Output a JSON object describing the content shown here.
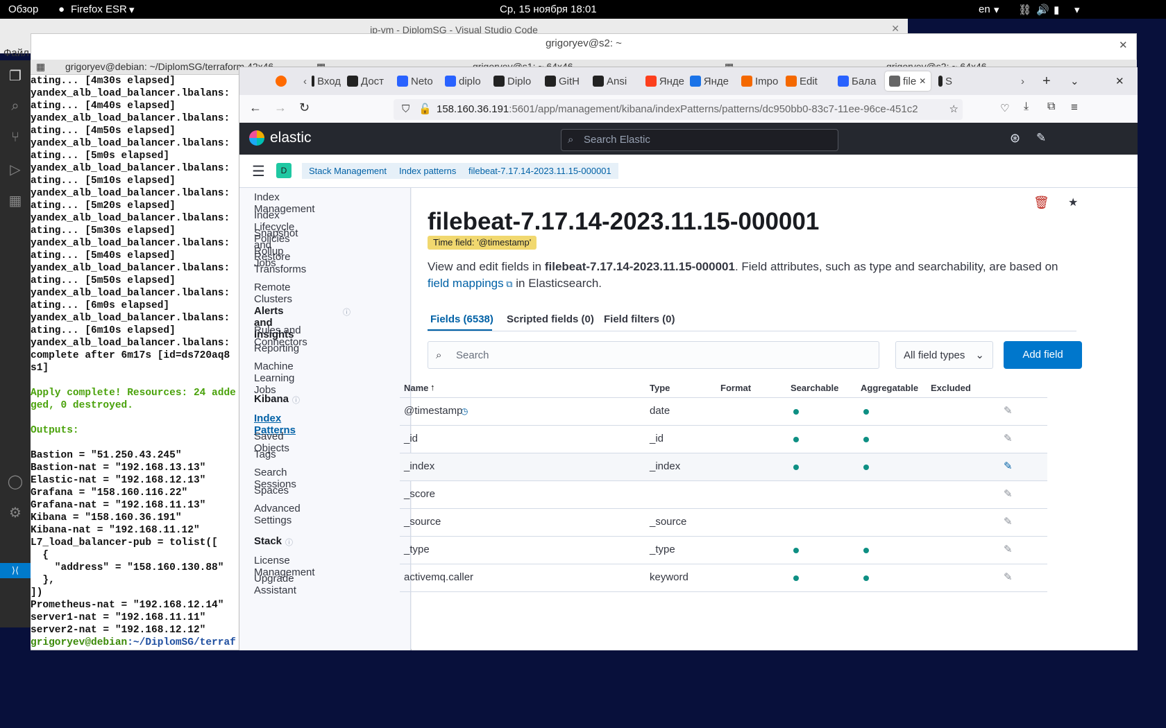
{
  "topbar": {
    "overview": "Обзор",
    "app": "Firefox ESR",
    "clock": "Ср, 15 ноября  18:01",
    "lang": "en"
  },
  "vscode": {
    "title": "ip-vm - DiplomSG - Visual Studio Code",
    "menu": "Файл"
  },
  "terminal": {
    "title": "grigoryev@s2: ~",
    "tabs": [
      "grigoryev@debian: ~/DiplomSG/terraform 42x46",
      "grigoryev@s1: ~ 64x46",
      "grigoryev@s2: ~ 64x46"
    ],
    "lines": [
      "ating... [4m30s elapsed]",
      "yandex_alb_load_balancer.lbalans:",
      "ating... [4m40s elapsed]",
      "yandex_alb_load_balancer.lbalans:",
      "ating... [4m50s elapsed]",
      "yandex_alb_load_balancer.lbalans:",
      "ating... [5m0s elapsed]",
      "yandex_alb_load_balancer.lbalans:",
      "ating... [5m10s elapsed]",
      "yandex_alb_load_balancer.lbalans:",
      "ating... [5m20s elapsed]",
      "yandex_alb_load_balancer.lbalans:",
      "ating... [5m30s elapsed]",
      "yandex_alb_load_balancer.lbalans:",
      "ating... [5m40s elapsed]",
      "yandex_alb_load_balancer.lbalans:",
      "ating... [5m50s elapsed]",
      "yandex_alb_load_balancer.lbalans:",
      "ating... [6m0s elapsed]",
      "yandex_alb_load_balancer.lbalans:",
      "ating... [6m10s elapsed]",
      "yandex_alb_load_balancer.lbalans:",
      "complete after 6m17s [id=ds720aq8",
      "s1]"
    ],
    "apply1": "Apply complete! Resources: 24 adde",
    "apply2": "ged, 0 destroyed.",
    "outputs": "Outputs:",
    "out_lines": [
      "Bastion = \"51.250.43.245\"",
      "Bastion-nat = \"192.168.13.13\"",
      "Elastic-nat = \"192.168.12.13\"",
      "Grafana = \"158.160.116.22\"",
      "Grafana-nat = \"192.168.11.13\"",
      "Kibana = \"158.160.36.191\"",
      "Kibana-nat = \"192.168.11.12\"",
      "L7_load_balancer-pub = tolist([",
      "  {",
      "    \"address\" = \"158.160.130.88\"",
      "  },",
      "])",
      "Prometheus-nat = \"192.168.12.14\"",
      "server1-nat = \"192.168.11.11\"",
      "server2-nat = \"192.168.12.12\""
    ],
    "prompt_user": "grigoryev@debian",
    "prompt_path": ":~/DiplomSG/terraf"
  },
  "browser": {
    "tabs": [
      {
        "label": "Вход",
        "fav": "ya-icon",
        "color": "#222"
      },
      {
        "label": "Дост",
        "fav": "ya-icon",
        "color": "#222"
      },
      {
        "label": "Neto",
        "fav": "yc-icon",
        "color": "#2962ff"
      },
      {
        "label": "diplo",
        "fav": "yc-icon",
        "color": "#2962ff"
      },
      {
        "label": "Diplo",
        "fav": "github-icon",
        "color": "#222"
      },
      {
        "label": "GitH",
        "fav": "github-icon",
        "color": "#222"
      },
      {
        "label": "Ansi",
        "fav": "github-icon",
        "color": "#222"
      },
      {
        "label": "Янде",
        "fav": "yandex-icon",
        "color": "#fc3f1d"
      },
      {
        "label": "Янде",
        "fav": "cloud-icon",
        "color": "#1a73e8"
      },
      {
        "label": "Impo",
        "fav": "grafana-icon",
        "color": "#f46800"
      },
      {
        "label": "Edit",
        "fav": "grafana-icon",
        "color": "#f46800"
      },
      {
        "label": "Бала",
        "fav": "yc-icon",
        "color": "#2962ff"
      },
      {
        "label": "file",
        "fav": "kibana-icon",
        "color": "#666"
      },
      {
        "label": "S",
        "fav": "github-icon",
        "color": "#222"
      }
    ],
    "url_host": "158.160.36.191",
    "url_path": ":5601/app/management/kibana/indexPatterns/patterns/dc950bb0-83c7-11ee-96ce-451c2"
  },
  "kibana": {
    "brand": "elastic",
    "search_placeholder": "Search Elastic",
    "space": "D",
    "breadcrumbs": [
      "Stack Management",
      "Index patterns",
      "filebeat-7.17.14-2023.11.15-000001"
    ],
    "side_top": [
      "Index Management",
      "Index Lifecycle Policies",
      "Snapshot and Restore",
      "Rollup Jobs",
      "Transforms",
      "Remote Clusters"
    ],
    "side_alerts_head": "Alerts and Insights",
    "side_alerts": [
      "Rules and Connectors",
      "Reporting",
      "Machine Learning Jobs"
    ],
    "side_kibana_head": "Kibana",
    "side_kibana": [
      "Index Patterns",
      "Saved Objects",
      "Tags",
      "Search Sessions",
      "Spaces",
      "Advanced Settings"
    ],
    "side_stack_head": "Stack",
    "side_stack": [
      "License Management",
      "Upgrade Assistant"
    ],
    "title": "filebeat-7.17.14-2023.11.15-000001",
    "badge": "Time field: '@timestamp'",
    "desc_pre": "View and edit fields in ",
    "desc_bold": "filebeat-7.17.14-2023.11.15-000001",
    "desc_mid": ". Field attributes, such as type and searchability, are based on ",
    "desc_link": "field mappings",
    "desc_post": " in Elasticsearch.",
    "tabs": [
      "Fields (6538)",
      "Scripted fields (0)",
      "Field filters (0)"
    ],
    "field_search_placeholder": "Search",
    "field_types": "All field types",
    "add_field": "Add field",
    "columns": [
      "Name",
      "Type",
      "Format",
      "Searchable",
      "Aggregatable",
      "Excluded"
    ],
    "rows": [
      {
        "name": "@timestamp",
        "type": "date",
        "searchable": true,
        "aggregatable": true
      },
      {
        "name": "_id",
        "type": "_id",
        "searchable": true,
        "aggregatable": true
      },
      {
        "name": "_index",
        "type": "_index",
        "searchable": true,
        "aggregatable": true
      },
      {
        "name": "_score",
        "type": "",
        "searchable": false,
        "aggregatable": false
      },
      {
        "name": "_source",
        "type": "_source",
        "searchable": false,
        "aggregatable": false
      },
      {
        "name": "_type",
        "type": "_type",
        "searchable": true,
        "aggregatable": true
      },
      {
        "name": "activemq.caller",
        "type": "keyword",
        "searchable": true,
        "aggregatable": true
      }
    ]
  }
}
